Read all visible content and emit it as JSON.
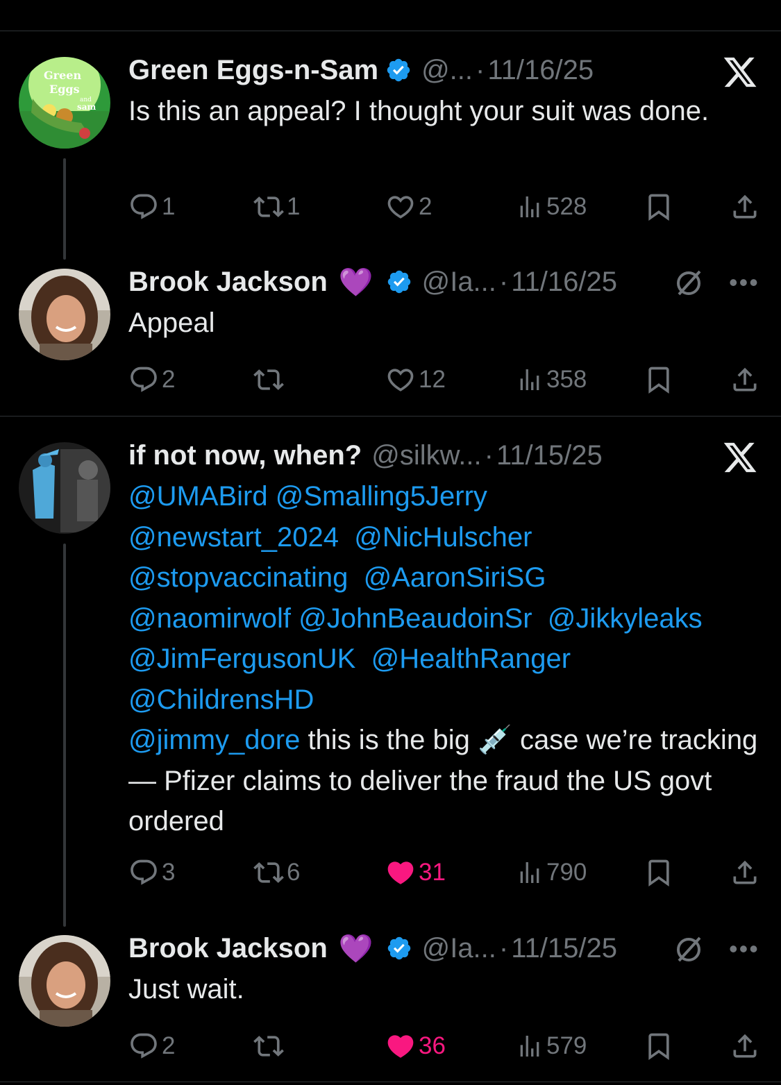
{
  "colors": {
    "background": "#000000",
    "text": "#e7e9ea",
    "muted": "#71767b",
    "link": "#1d9bf0",
    "like": "#f91880",
    "verified": "#1d9bf0",
    "divider": "#2f3336"
  },
  "tweets": [
    {
      "name": "Green Eggs-n-Sam",
      "handle": "@...",
      "dot": "·",
      "date": "11/16/25",
      "badge": "verified-badge-icon",
      "corner_icon": "x-logo-icon",
      "body": "Is this an appeal? I thought your suit was done.",
      "avatar_text": {
        "line1": "Green",
        "line2": "Eggs",
        "line3": "and",
        "line4": "sam"
      },
      "replies": "1",
      "reposts": "1",
      "likes": "2",
      "views": "528",
      "liked": false
    },
    {
      "name": "Brook Jackson",
      "emoji": "💜",
      "handle": "@Ia...",
      "dot": "·",
      "date": "11/16/25",
      "badge": "verified-badge-icon",
      "corner_icon": "more-icon",
      "body": "Appeal",
      "replies": "2",
      "reposts": "",
      "likes": "12",
      "views": "358",
      "liked": false
    },
    {
      "name": "if not now, when?",
      "handle": "@silkw...",
      "dot": "·",
      "date": "11/15/25",
      "corner_icon": "x-logo-icon",
      "mentions": {
        "m1": "@UMABird",
        "m2": "@Smalling5Jerry",
        "m3": "@newstart_2024",
        "m4": "@NicHulscher",
        "m5": "@stopvaccinating",
        "m6": "@AaronSiriSG",
        "m7": "@naomirwolf",
        "m8": "@JohnBeaudoinSr",
        "m9": "@Jikkyleaks",
        "m10": "@JimFergusonUK",
        "m11": "@HealthRanger",
        "m12": "@ChildrensHD",
        "m13": "@jimmy_dore"
      },
      "text1": " this is the big ",
      "emoji": "💉",
      "text2": " case we’re tracking — Pfizer claims to deliver the fraud the US govt ordered",
      "replies": "3",
      "reposts": "6",
      "likes": "31",
      "views": "790",
      "liked": true
    },
    {
      "name": "Brook Jackson",
      "emoji": "💜",
      "handle": "@Ia...",
      "dot": "·",
      "date": "11/15/25",
      "badge": "verified-badge-icon",
      "corner_icon": "more-icon",
      "body": "Just wait.",
      "replies": "2",
      "reposts": "",
      "likes": "36",
      "views": "579",
      "liked": true
    }
  ]
}
